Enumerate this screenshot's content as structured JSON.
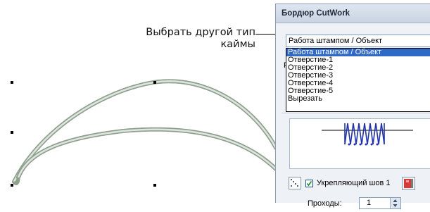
{
  "callout": {
    "line1": "Выбрать другой тип",
    "line2": "каймы"
  },
  "panel": {
    "title": "Бордюр CutWork",
    "border_type_selected": "Работа штампом / Объект",
    "dropdown_options": [
      "Работа штампом / Объект",
      "Отверстие-1",
      "Отверстие-2",
      "Отверстие-3",
      "Отверстие-4",
      "Отверстие-5",
      "Вырезать"
    ],
    "obscured_label_char": "Р",
    "reinforce_label": "Укрепляющий шов 1",
    "reinforce_checked": true,
    "passes_label": "Проходы:",
    "passes_value": "1"
  },
  "icons": {
    "stitch_type": "diagonal-dots-icon",
    "color": "color-swatch-icon",
    "preview": "zigzag-stitch-preview-icon",
    "spinner": "spinner-arrows-icon"
  },
  "colors": {
    "selection": "#3169c6",
    "swatch_red": "#d63a3a",
    "stitch_blue": "#2233aa"
  }
}
